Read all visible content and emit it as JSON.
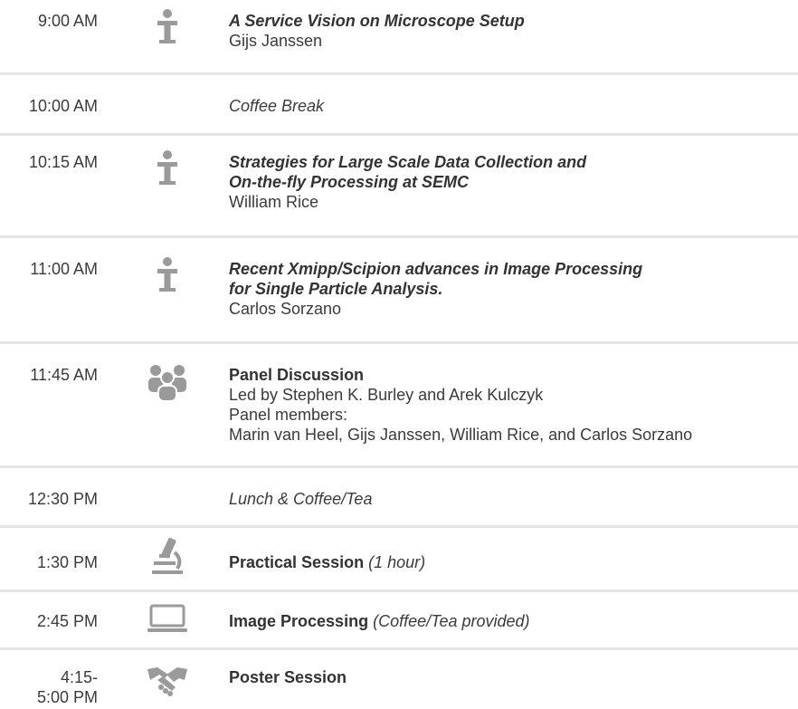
{
  "colors": {
    "text": "#3b3b3b",
    "icon": "#9a9a9a",
    "divider": "#e5e5e5"
  },
  "schedule": [
    {
      "time": "9:00 AM",
      "icon": "podium-icon",
      "title": "A Service Vision on Microscope Setup",
      "title_line2": "",
      "speaker": "Gijs Janssen"
    },
    {
      "time": "10:00 AM",
      "icon": "",
      "text": "Coffee Break"
    },
    {
      "time": "10:15 AM",
      "icon": "podium-icon",
      "title": "Strategies for Large Scale Data Collection and",
      "title_line2": "On-the-fly Processing at SEMC",
      "speaker": "William Rice"
    },
    {
      "time": "11:00 AM",
      "icon": "podium-icon",
      "title": "Recent Xmipp/Scipion advances in Image Processing",
      "title_line2": "for Single Particle Analysis.",
      "speaker": "Carlos Sorzano"
    },
    {
      "time": "11:45 AM",
      "icon": "group-icon",
      "title": "Panel Discussion",
      "lines": [
        "Led by Stephen K. Burley and Arek Kulczyk",
        "Panel members:",
        "Marin van Heel, Gijs Janssen, William Rice, and Carlos Sorzano"
      ]
    },
    {
      "time": "12:30 PM",
      "icon": "",
      "text": "Lunch & Coffee/Tea"
    },
    {
      "time": "1:30 PM",
      "icon": "microscope-icon",
      "title": "Practical Session",
      "note": "(1 hour)"
    },
    {
      "time": "2:45 PM",
      "icon": "laptop-icon",
      "title": "Image Processing",
      "note": "(Coffee/Tea provided)"
    },
    {
      "time": "4:15-",
      "time_line2": "5:00 PM",
      "icon": "handshake-icon",
      "title": "Poster Session"
    }
  ]
}
